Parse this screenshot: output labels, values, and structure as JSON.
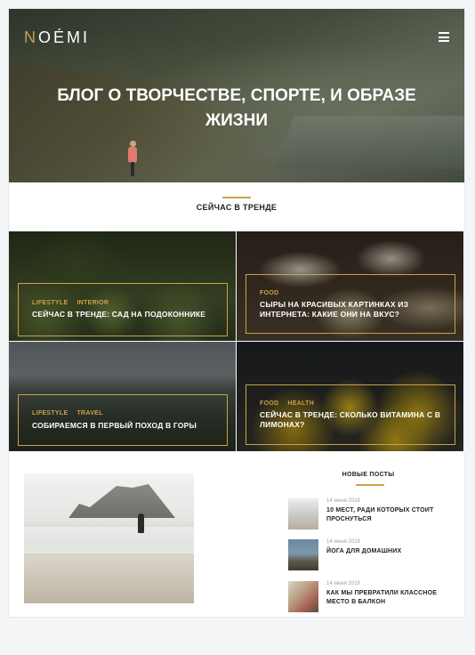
{
  "header": {
    "logo_first": "N",
    "logo_rest": "OÉMI",
    "menu_icon": "hamburger-icon",
    "accent_color": "#c9a14a"
  },
  "hero": {
    "title": "БЛОГ О ТВОРЧЕСТВЕ, СПОРТЕ, И ОБРАЗЕ ЖИЗНИ"
  },
  "trending": {
    "title": "СЕЙЧАС В ТРЕНДЕ",
    "cards": [
      {
        "cat1": "LIFESTYLE",
        "cat2": "INTERIOR",
        "title": "СЕЙЧАС В ТРЕНДЕ: САД НА ПОДОКОННИКЕ"
      },
      {
        "cat1": "FOOD",
        "cat2": "",
        "title": "СЫРЫ НА КРАСИВЫХ КАРТИНКАХ ИЗ ИНТЕРНЕТА: КАКИЕ ОНИ НА ВКУС?"
      },
      {
        "cat1": "LIFESTYLE",
        "cat2": "TRAVEL",
        "title": "СОБИРАЕМСЯ В ПЕРВЫЙ ПОХОД В ГОРЫ"
      },
      {
        "cat1": "FOOD",
        "cat2": "HEALTH",
        "title": "СЕЙЧАС В ТРЕНДЕ: СКОЛЬКО ВИТАМИНА С В ЛИМОНАХ?"
      }
    ]
  },
  "new_posts": {
    "title": "НОВЫЕ ПОСТЫ",
    "items": [
      {
        "date": "14 июня 2019",
        "title": "10 МЕСТ, РАДИ КОТОРЫХ СТОИТ ПРОСНУТЬСЯ"
      },
      {
        "date": "14 июня 2019",
        "title": "ЙОГА ДЛЯ ДОМАШНИХ"
      },
      {
        "date": "14 июня 2019",
        "title": "КАК МЫ ПРЕВРАТИЛИ КЛАССНОЕ МЕСТО В БАЛКОН"
      }
    ]
  }
}
